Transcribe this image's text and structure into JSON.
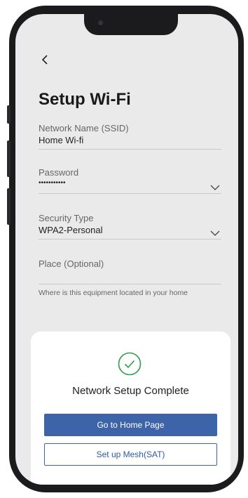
{
  "header": {
    "title": "Setup Wi-Fi"
  },
  "form": {
    "network_name": {
      "label": "Network Name (SSID)",
      "value": "Home Wi-fi"
    },
    "password": {
      "label": "Password",
      "value": "•••••••••••"
    },
    "security_type": {
      "label": "Security Type",
      "value": "WPA2-Personal"
    },
    "place": {
      "label": "Place (Optional)",
      "value": "",
      "hint": "Where is this equipment located in your home"
    }
  },
  "dialog": {
    "message": "Network Setup Complete",
    "primary_button": "Go to Home Page",
    "secondary_button": "Set up Mesh(SAT)"
  },
  "colors": {
    "accent": "#3d63a9",
    "success": "#2e9e4a",
    "screen_bg": "#eaeaea"
  },
  "icons": [
    "back-arrow-icon",
    "chevron-down-icon",
    "check-circle-icon"
  ]
}
